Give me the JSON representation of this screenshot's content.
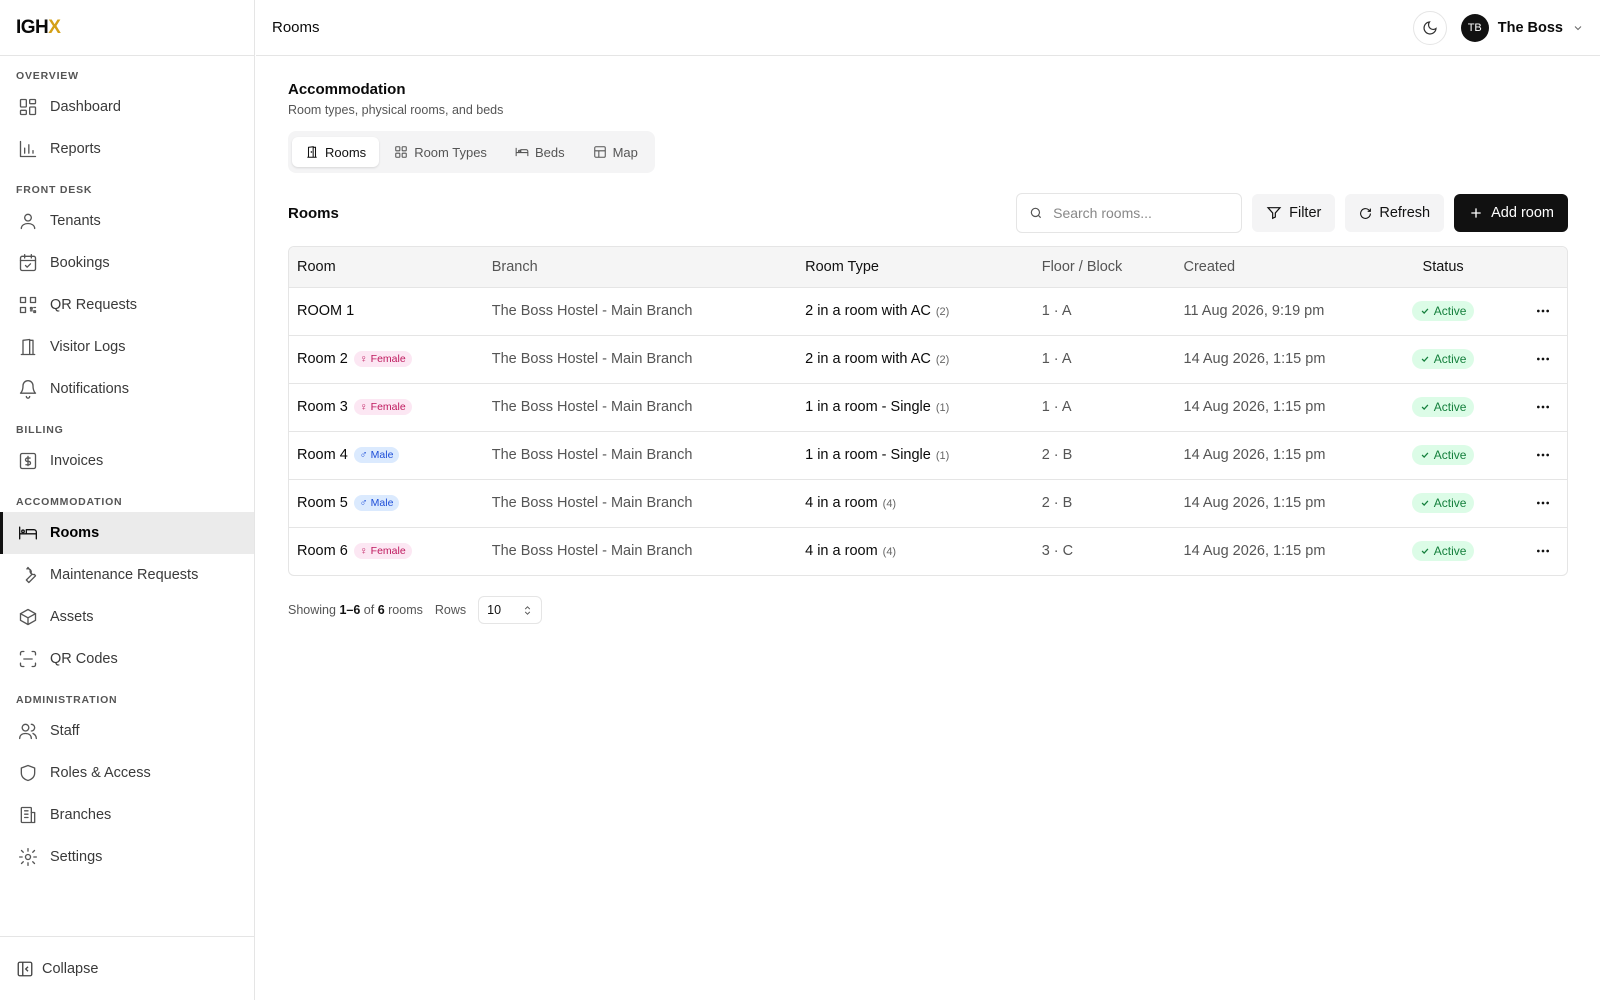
{
  "app": {
    "logo_main": "IGH",
    "logo_accent": "X",
    "collapse_label": "Collapse"
  },
  "sidebar": {
    "sections": [
      {
        "title": "OVERVIEW",
        "items": [
          {
            "label": "Dashboard",
            "icon": "dashboard-icon"
          },
          {
            "label": "Reports",
            "icon": "chart-icon"
          }
        ]
      },
      {
        "title": "FRONT DESK",
        "items": [
          {
            "label": "Tenants",
            "icon": "user-icon"
          },
          {
            "label": "Bookings",
            "icon": "calendar-check-icon"
          },
          {
            "label": "QR Requests",
            "icon": "qr-icon"
          },
          {
            "label": "Visitor Logs",
            "icon": "door-icon"
          },
          {
            "label": "Notifications",
            "icon": "bell-icon"
          }
        ]
      },
      {
        "title": "BILLING",
        "items": [
          {
            "label": "Invoices",
            "icon": "dollar-icon"
          }
        ]
      },
      {
        "title": "ACCOMMODATION",
        "items": [
          {
            "label": "Rooms",
            "icon": "bed-icon"
          },
          {
            "label": "Maintenance Requests",
            "icon": "wrench-icon"
          },
          {
            "label": "Assets",
            "icon": "box-icon"
          },
          {
            "label": "QR Codes",
            "icon": "scan-icon"
          }
        ]
      },
      {
        "title": "ADMINISTRATION",
        "items": [
          {
            "label": "Staff",
            "icon": "users-icon"
          },
          {
            "label": "Roles & Access",
            "icon": "shield-icon"
          },
          {
            "label": "Branches",
            "icon": "building-icon"
          },
          {
            "label": "Settings",
            "icon": "gear-icon"
          }
        ]
      }
    ],
    "active": "Rooms"
  },
  "topbar": {
    "title": "Rooms",
    "user_initials": "TB",
    "user_name": "The Boss"
  },
  "page": {
    "title": "Accommodation",
    "subtitle": "Room types, physical rooms, and beds",
    "tabs": [
      "Rooms",
      "Room Types",
      "Beds",
      "Map"
    ],
    "active_tab": "Rooms"
  },
  "toolbar": {
    "section_title": "Rooms",
    "search_placeholder": "Search rooms...",
    "filter_label": "Filter",
    "refresh_label": "Refresh",
    "add_label": "Add room"
  },
  "table": {
    "columns": [
      "Room",
      "Branch",
      "Room Type",
      "Floor / Block",
      "Created",
      "Status"
    ],
    "rows": [
      {
        "room": "ROOM 1",
        "gender": "",
        "branch": "The Boss Hostel - Main Branch",
        "room_type": "2 in a room with AC",
        "capacity": "(2)",
        "floor": "1 · A",
        "created": "11 Aug 2026, 9:19 pm",
        "status": "Active"
      },
      {
        "room": "Room 2",
        "gender": "Female",
        "branch": "The Boss Hostel - Main Branch",
        "room_type": "2 in a room with AC",
        "capacity": "(2)",
        "floor": "1 · A",
        "created": "14 Aug 2026, 1:15 pm",
        "status": "Active"
      },
      {
        "room": "Room 3",
        "gender": "Female",
        "branch": "The Boss Hostel - Main Branch",
        "room_type": "1 in a room - Single",
        "capacity": "(1)",
        "floor": "1 · A",
        "created": "14 Aug 2026, 1:15 pm",
        "status": "Active"
      },
      {
        "room": "Room 4",
        "gender": "Male",
        "branch": "The Boss Hostel - Main Branch",
        "room_type": "1 in a room - Single",
        "capacity": "(1)",
        "floor": "2 · B",
        "created": "14 Aug 2026, 1:15 pm",
        "status": "Active"
      },
      {
        "room": "Room 5",
        "gender": "Male",
        "branch": "The Boss Hostel - Main Branch",
        "room_type": "4 in a room",
        "capacity": "(4)",
        "floor": "2 · B",
        "created": "14 Aug 2026, 1:15 pm",
        "status": "Active"
      },
      {
        "room": "Room 6",
        "gender": "Female",
        "branch": "The Boss Hostel - Main Branch",
        "room_type": "4 in a room",
        "capacity": "(4)",
        "floor": "3 · C",
        "created": "14 Aug 2026, 1:15 pm",
        "status": "Active"
      }
    ]
  },
  "pager": {
    "showing_prefix": "Showing",
    "range": "1–6",
    "of": "of",
    "total": "6",
    "suffix": "rooms",
    "rows_label": "Rows",
    "rows_value": "10"
  },
  "colors": {
    "accent": "#d4a017",
    "primary_button": "#111111",
    "active_status_bg": "#dcfce7",
    "active_status_text": "#15803d",
    "female_badge": "#be185d",
    "male_badge": "#1d4ed8"
  }
}
